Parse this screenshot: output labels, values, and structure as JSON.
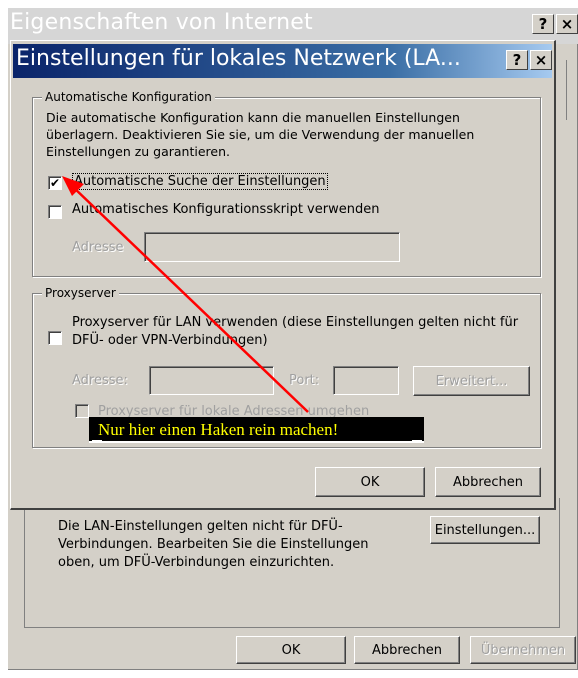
{
  "outer_window": {
    "title": "Eigenschaften von Internet",
    "help_label": "?",
    "close_label": "×",
    "lan_note": "Die LAN-Einstellungen gelten nicht für DFÜ-Verbindungen. Bearbeiten Sie die Einstellungen oben, um DFÜ-Verbindungen einzurichten.",
    "settings_button": "Einstellungen...",
    "ok_button": "OK",
    "cancel_button": "Abbrechen",
    "apply_button": "Übernehmen"
  },
  "dialog": {
    "title": "Einstellungen für lokales Netzwerk (LA...",
    "help_label": "?",
    "close_label": "×",
    "auto_config": {
      "legend": "Automatische Konfiguration",
      "description": "Die automatische Konfiguration kann die manuellen Einstellungen überlagern. Deaktivieren Sie sie, um die Verwendung der manuellen Einstellungen zu garantieren.",
      "auto_detect_label": "Automatische Suche der Einstellungen",
      "auto_detect_checked": true,
      "auto_detect_mark": "✔",
      "auto_script_label": "Automatisches Konfigurationsskript verwenden",
      "auto_script_checked": false,
      "address_label": "Adresse",
      "address_value": ""
    },
    "proxy": {
      "legend": "Proxyserver",
      "use_proxy_label": "Proxyserver für LAN verwenden (diese Einstellungen gelten nicht für DFÜ- oder VPN-Verbindungen)",
      "use_proxy_checked": false,
      "address_label": "Adresse:",
      "address_value": "",
      "port_label": "Port:",
      "port_value": "",
      "advanced_button": "Erweitert...",
      "bypass_label": "Proxyserver für lokale Adressen umgehen",
      "bypass_checked": false
    },
    "ok_button": "OK",
    "cancel_button": "Abbrechen"
  },
  "annotation": {
    "text": "Nur hier einen Haken rein machen!",
    "color": "#ffff00",
    "arrow_color": "#ff0000"
  }
}
